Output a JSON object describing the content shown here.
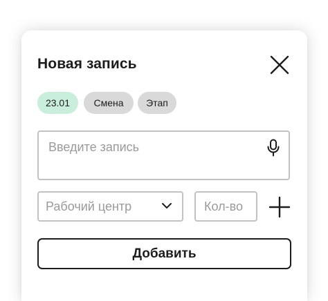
{
  "dialog": {
    "title": "Новая запись"
  },
  "chips": [
    {
      "label": "23.01",
      "color": "#c9efdc"
    },
    {
      "label": "Смена",
      "color": "#d9d9d9"
    },
    {
      "label": "Этап",
      "color": "#d9d9d9"
    }
  ],
  "entry": {
    "placeholder": "Введите запись",
    "icon": "microphone-icon"
  },
  "work_center": {
    "placeholder": "Рабочий центр",
    "icon": "chevron-down-icon"
  },
  "quantity": {
    "placeholder": "Кол-во"
  },
  "icons": {
    "close": "close-icon",
    "plus": "plus-icon"
  },
  "actions": {
    "add_label": "Добавить"
  }
}
